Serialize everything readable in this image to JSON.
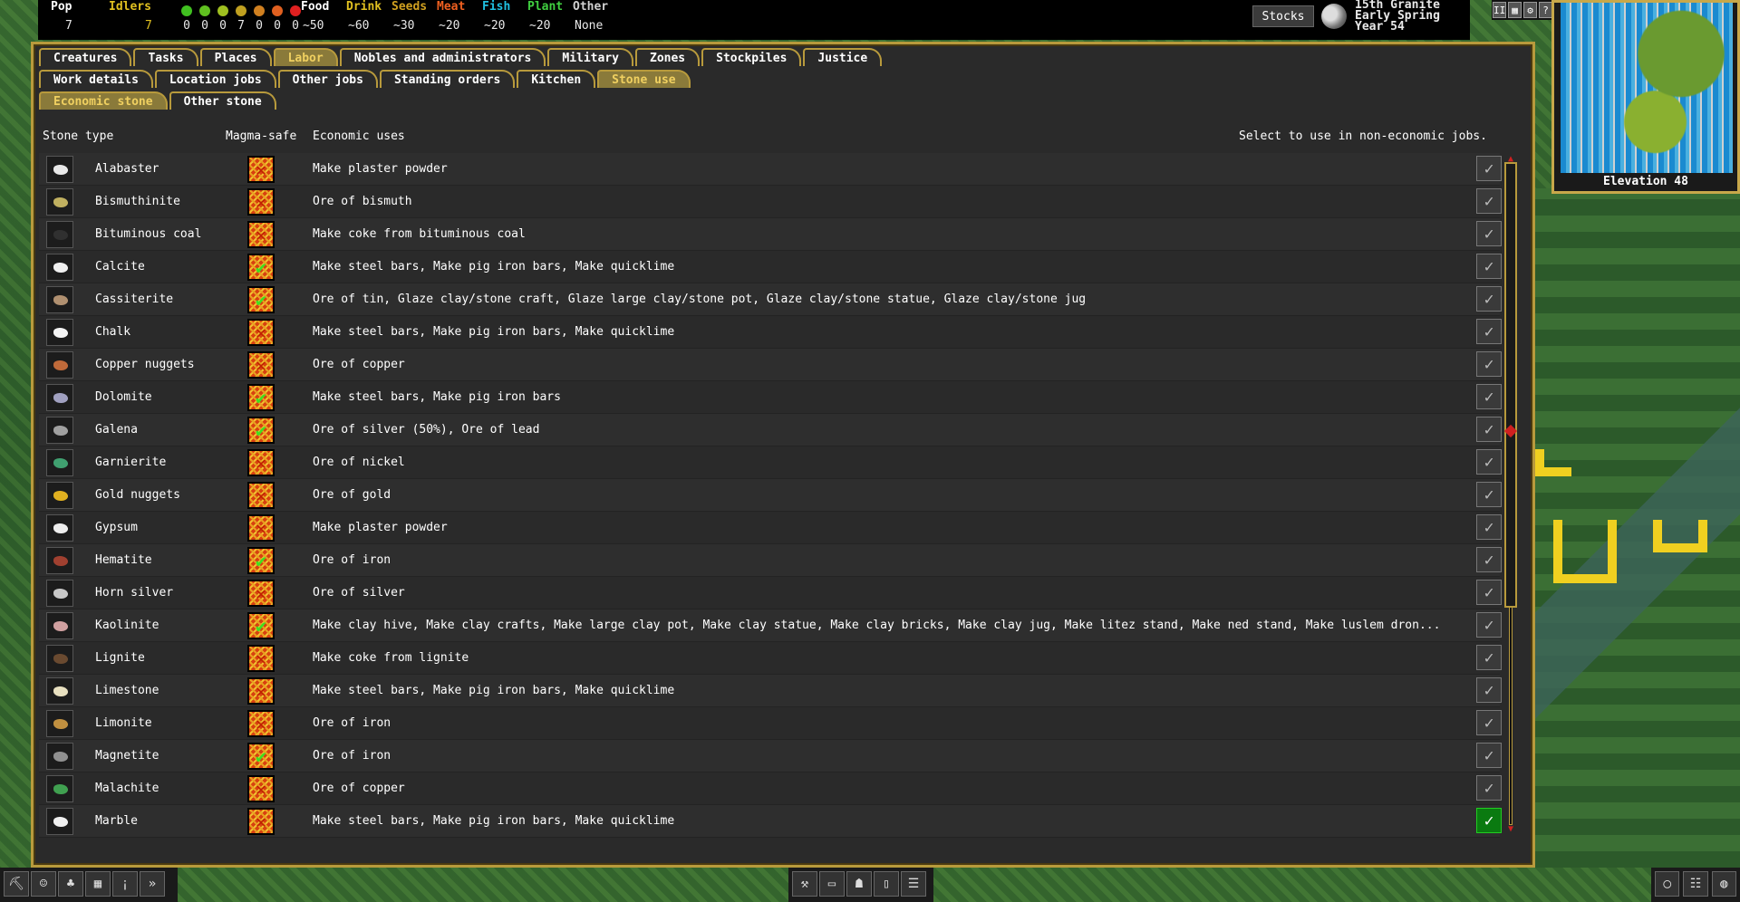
{
  "topbar": {
    "pop_label": "Pop",
    "pop_value": "7",
    "idlers_label": "Idlers",
    "idlers_value": "7",
    "mood_counts": [
      "0",
      "0",
      "0",
      "7",
      "0",
      "0",
      "0"
    ],
    "mood_colors": [
      "#40c020",
      "#60c020",
      "#a0c020",
      "#c0a020",
      "#d08020",
      "#e06020",
      "#e02020"
    ],
    "stocks": [
      {
        "label": "Food",
        "value": "~50",
        "color": "#ffffff"
      },
      {
        "label": "Drink",
        "value": "~60",
        "color": "#e0c020"
      },
      {
        "label": "Seeds",
        "value": "~30",
        "color": "#d0a020"
      },
      {
        "label": "Meat",
        "value": "~20",
        "color": "#f06020"
      },
      {
        "label": "Fish",
        "value": "~20",
        "color": "#20c0e0"
      },
      {
        "label": "Plant",
        "value": "~20",
        "color": "#40d040"
      },
      {
        "label": "Other",
        "value": "None",
        "color": "#d0d0d0"
      }
    ],
    "stocks_button": "Stocks",
    "date_line1": "15th Granite",
    "date_line2": "Early Spring",
    "date_line3": "Year 54",
    "controls": [
      "II",
      "▦",
      "⚙",
      "?"
    ]
  },
  "minimap": {
    "elevation": "Elevation 48"
  },
  "tabs_row1": [
    {
      "label": "Creatures",
      "active": false
    },
    {
      "label": "Tasks",
      "active": false
    },
    {
      "label": "Places",
      "active": false
    },
    {
      "label": "Labor",
      "active": true
    },
    {
      "label": "Nobles and administrators",
      "active": false
    },
    {
      "label": "Military",
      "active": false
    },
    {
      "label": "Zones",
      "active": false
    },
    {
      "label": "Stockpiles",
      "active": false
    },
    {
      "label": "Justice",
      "active": false
    }
  ],
  "tabs_row2": [
    {
      "label": "Work details",
      "active": false
    },
    {
      "label": "Location jobs",
      "active": false
    },
    {
      "label": "Other jobs",
      "active": false
    },
    {
      "label": "Standing orders",
      "active": false
    },
    {
      "label": "Kitchen",
      "active": false
    },
    {
      "label": "Stone use",
      "active": true
    }
  ],
  "tabs_row3": [
    {
      "label": "Economic stone",
      "active": true
    },
    {
      "label": "Other stone",
      "active": false
    }
  ],
  "headers": {
    "stone_type": "Stone type",
    "magma_safe": "Magma-safe",
    "economic_uses": "Economic uses",
    "select_hint": "Select to use in non-economic jobs."
  },
  "stones": [
    {
      "name": "Alabaster",
      "magma": false,
      "uses": "Make plaster powder",
      "selected": false,
      "color": "#e8e8e8"
    },
    {
      "name": "Bismuthinite",
      "magma": false,
      "uses": "Ore of bismuth",
      "selected": false,
      "color": "#c0b060"
    },
    {
      "name": "Bituminous coal",
      "magma": false,
      "uses": "Make coke from bituminous coal",
      "selected": false,
      "color": "#303030"
    },
    {
      "name": "Calcite",
      "magma": true,
      "uses": "Make steel bars, Make pig iron bars, Make quicklime",
      "selected": false,
      "color": "#f0f0f0"
    },
    {
      "name": "Cassiterite",
      "magma": true,
      "uses": "Ore of tin, Glaze clay/stone craft, Glaze large clay/stone pot, Glaze clay/stone statue, Glaze clay/stone jug",
      "selected": false,
      "color": "#b09070"
    },
    {
      "name": "Chalk",
      "magma": false,
      "uses": "Make steel bars, Make pig iron bars, Make quicklime",
      "selected": false,
      "color": "#f4f4f4"
    },
    {
      "name": "Copper nuggets",
      "magma": false,
      "uses": "Ore of copper",
      "selected": false,
      "color": "#c06a3a"
    },
    {
      "name": "Dolomite",
      "magma": true,
      "uses": "Make steel bars, Make pig iron bars",
      "selected": false,
      "color": "#a0a0c0"
    },
    {
      "name": "Galena",
      "magma": true,
      "uses": "Ore of silver (50%), Ore of lead",
      "selected": false,
      "color": "#a0a0a0"
    },
    {
      "name": "Garnierite",
      "magma": false,
      "uses": "Ore of nickel",
      "selected": false,
      "color": "#40a070"
    },
    {
      "name": "Gold nuggets",
      "magma": false,
      "uses": "Ore of gold",
      "selected": false,
      "color": "#e0b020"
    },
    {
      "name": "Gypsum",
      "magma": false,
      "uses": "Make plaster powder",
      "selected": false,
      "color": "#eeeeee"
    },
    {
      "name": "Hematite",
      "magma": true,
      "uses": "Ore of iron",
      "selected": false,
      "color": "#a04030"
    },
    {
      "name": "Horn silver",
      "magma": false,
      "uses": "Ore of silver",
      "selected": false,
      "color": "#c8c8c8"
    },
    {
      "name": "Kaolinite",
      "magma": true,
      "uses": "Make clay hive, Make clay crafts, Make large clay pot, Make clay statue, Make clay bricks, Make clay jug, Make litez stand, Make ned stand, Make luslem dron...",
      "selected": false,
      "color": "#d0a0a0"
    },
    {
      "name": "Lignite",
      "magma": false,
      "uses": "Make coke from lignite",
      "selected": false,
      "color": "#6a4a30"
    },
    {
      "name": "Limestone",
      "magma": false,
      "uses": "Make steel bars, Make pig iron bars, Make quicklime",
      "selected": false,
      "color": "#e8e0c0"
    },
    {
      "name": "Limonite",
      "magma": false,
      "uses": "Ore of iron",
      "selected": false,
      "color": "#c09040"
    },
    {
      "name": "Magnetite",
      "magma": true,
      "uses": "Ore of iron",
      "selected": false,
      "color": "#909090"
    },
    {
      "name": "Malachite",
      "magma": false,
      "uses": "Ore of copper",
      "selected": false,
      "color": "#40a050"
    },
    {
      "name": "Marble",
      "magma": false,
      "uses": "Make steel bars, Make pig iron bars, Make quicklime",
      "selected": true,
      "color": "#f0f0f0"
    }
  ],
  "bottombar": {
    "left_icons": [
      "pickaxe-icon",
      "dwarf-icon",
      "creature-icon",
      "map-icon",
      "lever-icon",
      "fast-forward-icon"
    ],
    "mid_icons": [
      "hammer-icon",
      "bed-icon",
      "workshop-icon",
      "door-icon",
      "hatch-icon"
    ],
    "right_icons": [
      "portal-icon",
      "notes-icon",
      "world-icon"
    ]
  }
}
